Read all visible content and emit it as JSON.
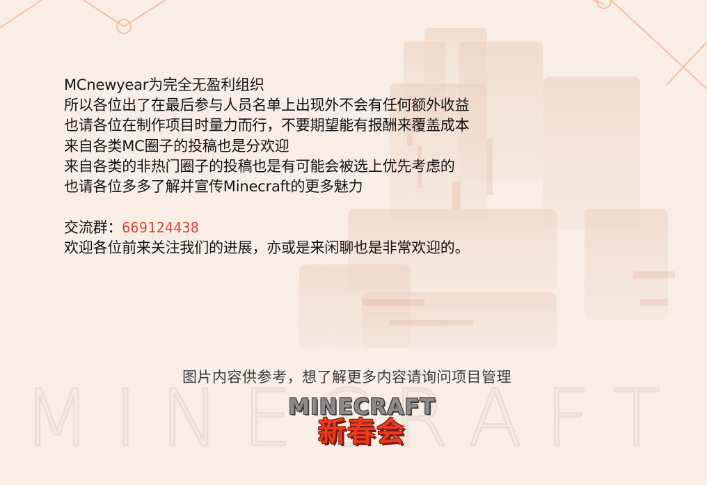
{
  "colors": {
    "background": "#f8eee5",
    "text": "#141414",
    "accent_number": "#d4483b",
    "footer_text": "#3c3a39",
    "logo_red": "#ec3a20"
  },
  "lines": [
    "MCnewyear为完全无盈利组织",
    "所以各位出了在最后参与人员名单上出现外不会有任何额外收益",
    "也请各位在制作项目时量力而行，不要期望能有报酬来覆盖成本",
    "来自各类MC圈子的投稿也是分欢迎",
    "来自各类的非热门圈子的投稿也是有可能会被选上优先考虑的",
    "也请各位多多了解并宣传Minecraft的更多魅力"
  ],
  "group": {
    "label": "交流群：",
    "number": "669124438"
  },
  "welcome": "欢迎各位前来关注我们的进展，亦或是来闲聊也是非常欢迎的。",
  "footer_note": "图片内容供参考，想了解更多内容请询问项目管理",
  "logo": {
    "line1": "MINECRAFT",
    "line2": "新春会"
  },
  "watermark": "MINECRAFT"
}
